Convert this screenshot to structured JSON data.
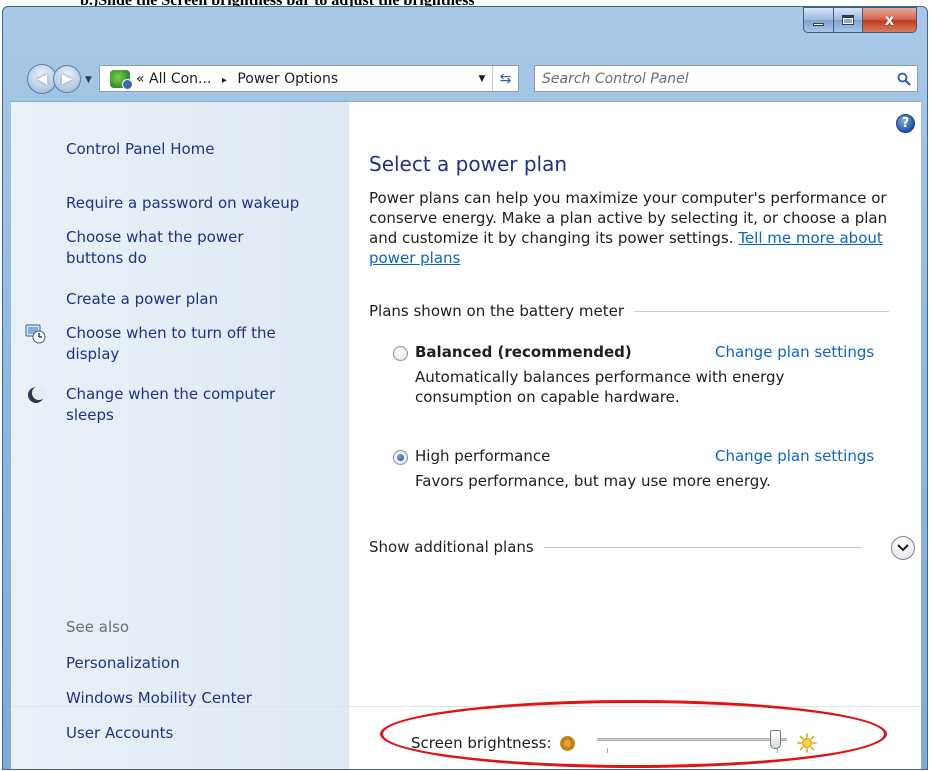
{
  "caption": "b.)Slide the Screen brightness bar to adjust the brightness",
  "window": {
    "minimize_icon": "minimize-icon",
    "maximize_icon": "maximize-icon",
    "close_label": "x"
  },
  "address_bar": {
    "chevron": "«",
    "breadcrumb_1": "All Con...",
    "breadcrumb_sep": "▸",
    "breadcrumb_2": "Power Options",
    "dropdown": "▼",
    "refresh": "⇆"
  },
  "search": {
    "placeholder": "Search Control Panel"
  },
  "sidebar": {
    "home": "Control Panel Home",
    "items": [
      {
        "label": "Require a password on wakeup"
      },
      {
        "label": "Choose what the power\nbuttons do"
      },
      {
        "label": "Create a power plan"
      },
      {
        "label": "Choose when to turn off the\ndisplay",
        "icon": "display-clock-icon"
      },
      {
        "label": "Change when the computer\nsleeps",
        "icon": "moon-sleep-icon"
      }
    ],
    "see_also": "See also",
    "see_also_links": [
      "Personalization",
      "Windows Mobility Center",
      "User Accounts"
    ]
  },
  "main": {
    "title": "Select a power plan",
    "description": "Power plans can help you maximize your computer's performance or conserve energy. Make a plan active by selecting it, or choose a plan and customize it by changing its power settings. ",
    "description_link": "Tell me more about power plans",
    "section_label": "Plans shown on the battery meter",
    "plans": [
      {
        "name": "Balanced (recommended)",
        "selected": false,
        "link": "Change plan settings",
        "description": "Automatically balances performance with energy\nconsumption on capable hardware."
      },
      {
        "name": "High performance",
        "selected": true,
        "link": "Change plan settings",
        "description": "Favors performance, but may use more energy."
      }
    ],
    "show_additional": "Show additional plans"
  },
  "brightness": {
    "label": "Screen brightness:",
    "value_fraction": 0.97
  },
  "colors": {
    "link": "#1e3287",
    "hyperlink": "#0b66c3",
    "highlight_oval": "#e01414"
  }
}
